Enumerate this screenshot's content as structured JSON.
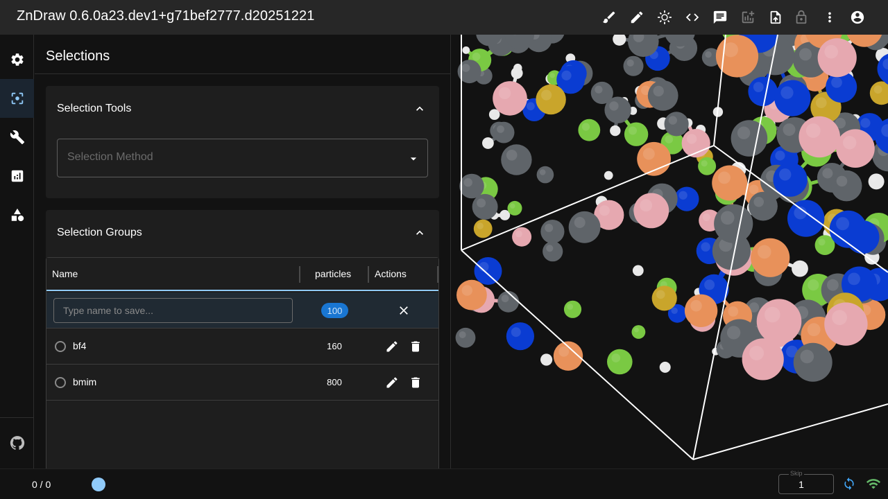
{
  "app": {
    "title": "ZnDraw 0.6.0a23.dev1+g71bef2777.d20251221"
  },
  "toolbar": {
    "icons": [
      "brush-icon",
      "pencil-icon",
      "brightness-icon",
      "code-icon",
      "chat-icon",
      "add-chart-icon",
      "file-upload-icon",
      "lock-icon",
      "more-vert-icon",
      "account-circle-icon"
    ],
    "disabled": [
      "add-chart-icon",
      "lock-icon"
    ]
  },
  "sidebar": {
    "items": [
      {
        "name": "settings",
        "icon": "gear-icon",
        "active": false
      },
      {
        "name": "selections",
        "icon": "center-focus-icon",
        "active": true
      },
      {
        "name": "modifiers",
        "icon": "wrench-icon",
        "active": false
      },
      {
        "name": "analysis",
        "icon": "chart-icon",
        "active": false
      },
      {
        "name": "geometries",
        "icon": "shapes-icon",
        "active": false
      }
    ],
    "footer_icon": "github-icon"
  },
  "panel": {
    "title": "Selections",
    "tools": {
      "title": "Selection Tools",
      "method_placeholder": "Selection Method"
    },
    "groups": {
      "title": "Selection Groups",
      "columns": {
        "name": "Name",
        "particles": "particles",
        "actions": "Actions"
      },
      "new_row": {
        "placeholder": "Type name to save...",
        "count": "100"
      },
      "rows": [
        {
          "name": "bf4",
          "particles": "160"
        },
        {
          "name": "bmim",
          "particles": "800"
        }
      ]
    }
  },
  "bottom": {
    "frame_counter": "0 / 0",
    "skip_label": "Skip",
    "skip_value": "1"
  },
  "colors": {
    "accent": "#90caf9",
    "chip": "#1976d2",
    "carbon": "#5f6469",
    "hydrogen": "#e8e8e8",
    "nitrogen": "#0a3cd2",
    "fluorine": "#7ac943",
    "boron": "#e6a8b0",
    "orange": "#e8915a",
    "yellow": "#c9a52b"
  }
}
